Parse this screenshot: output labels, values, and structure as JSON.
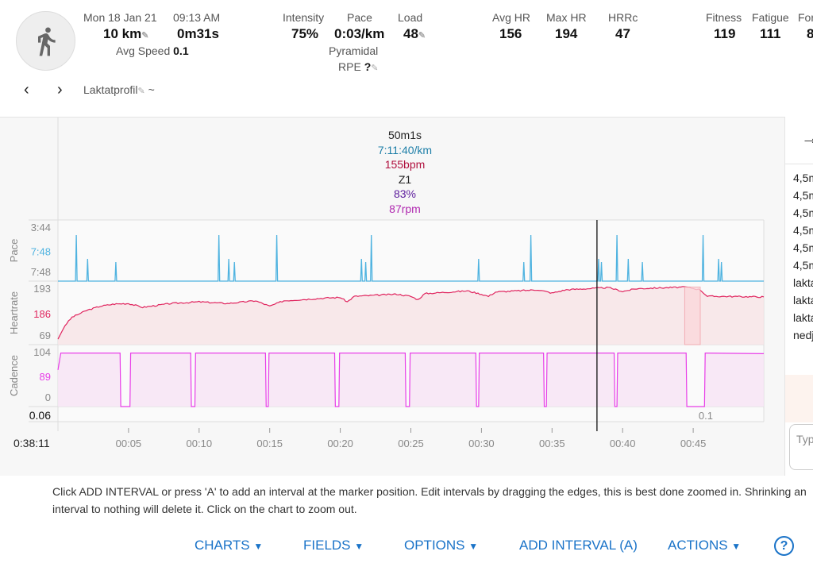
{
  "header": {
    "date": "Mon 18 Jan 21",
    "time": "09:13 AM",
    "distance": "10 km",
    "duration": "0m31s",
    "avg_speed_label": "Avg Speed",
    "avg_speed": "0.1",
    "intensity_label": "Intensity",
    "intensity": "75%",
    "pace_label": "Pace",
    "pace": "0:03/km",
    "load_label": "Load",
    "load": "48",
    "type": "Pyramidal",
    "rpe_label": "RPE",
    "rpe": "?",
    "avg_hr_label": "Avg HR",
    "avg_hr": "156",
    "max_hr_label": "Max HR",
    "max_hr": "194",
    "hrrc_label": "HRRc",
    "hrrc": "47",
    "fitness_label": "Fitness",
    "fitness": "119",
    "fatigue_label": "Fatigue",
    "fatigue": "111",
    "form_label": "For",
    "form": "8",
    "activity_name": "Laktatprofil",
    "activity_suffix": "~"
  },
  "tooltip": {
    "time": "50m1s",
    "pace": "7:11:40/km",
    "hr": "155bpm",
    "zone": "Z1",
    "pct": "83%",
    "cadence": "87rpm"
  },
  "chart_data": {
    "type": "line",
    "x_unit": "minutes",
    "xlim": [
      0,
      50
    ],
    "x_ticks": [
      "00:05",
      "00:10",
      "00:15",
      "00:20",
      "00:25",
      "00:30",
      "00:35",
      "00:40",
      "00:45"
    ],
    "marker_time": "0:38:11",
    "bottom_left_value": "0.06",
    "bottom_right_value": "0.1",
    "panels": [
      {
        "name": "Pace",
        "color": "#4fb3e0",
        "ticks": [
          "3:44",
          "7:48",
          "7:48"
        ],
        "highlight": "7:48",
        "spikes": [
          1.3,
          2.1,
          4.1,
          11.4,
          12.1,
          12.5,
          15.5,
          21.5,
          21.8,
          22.2,
          29.8,
          33.0,
          33.5,
          38.3,
          38.5,
          39.6,
          40.4,
          41.4,
          45.7,
          46.8,
          47.0
        ]
      },
      {
        "name": "Heartrate",
        "color": "#e0245e",
        "ticks": [
          "193",
          "186",
          "69"
        ],
        "highlight": "186",
        "points": [
          [
            0,
            100
          ],
          [
            0.5,
            125
          ],
          [
            1,
            140
          ],
          [
            2,
            152
          ],
          [
            3,
            160
          ],
          [
            4,
            164
          ],
          [
            5,
            165
          ],
          [
            6,
            158
          ],
          [
            8,
            165
          ],
          [
            10,
            168
          ],
          [
            12,
            165
          ],
          [
            14,
            170
          ],
          [
            15,
            160
          ],
          [
            16,
            170
          ],
          [
            19,
            175
          ],
          [
            20,
            176
          ],
          [
            20.5,
            168
          ],
          [
            21,
            178
          ],
          [
            24,
            182
          ],
          [
            25,
            178
          ],
          [
            25.5,
            172
          ],
          [
            26,
            183
          ],
          [
            29,
            188
          ],
          [
            30,
            182
          ],
          [
            30.5,
            178
          ],
          [
            31,
            186
          ],
          [
            34,
            190
          ],
          [
            35,
            184
          ],
          [
            36,
            190
          ],
          [
            39,
            194
          ],
          [
            40,
            187
          ],
          [
            41,
            192
          ],
          [
            44.5,
            195
          ],
          [
            45.5,
            190
          ],
          [
            46,
            178
          ],
          [
            47,
            178
          ],
          [
            50,
            177
          ]
        ]
      },
      {
        "name": "Cadence",
        "color": "#e83ee8",
        "ticks": [
          "104",
          "89",
          "0"
        ],
        "highlight": "89",
        "baseline": 95,
        "drops": [
          [
            4.4,
            5.1
          ],
          [
            9.4,
            9.7
          ],
          [
            14.7,
            14.9
          ],
          [
            19.6,
            19.9
          ],
          [
            24.6,
            24.9
          ],
          [
            29.6,
            29.8
          ],
          [
            34.4,
            34.6
          ],
          [
            39.4,
            39.6
          ],
          [
            44.5,
            45.8
          ]
        ]
      }
    ]
  },
  "side": {
    "items": [
      "4,5m",
      "4,5m",
      "4,5m",
      "4,5m",
      "4,5m",
      "4,5m",
      "laktat",
      "laktat",
      "laktat",
      "nedjo"
    ],
    "input_placeholder": "Type"
  },
  "help": {
    "text": "Click ADD INTERVAL or press 'A' to add an interval at the marker position. Edit intervals by dragging the edges, this is best done zoomed in. Shrinking an interval to nothing will delete it. Click on the chart to zoom out."
  },
  "toolbar": {
    "charts": "CHARTS",
    "fields": "FIELDS",
    "options": "OPTIONS",
    "add_interval": "ADD INTERVAL (A)",
    "actions": "ACTIONS",
    "help": "?"
  },
  "colors": {
    "accent": "#1a73c8",
    "pace": "#4fb3e0",
    "hr": "#e0245e",
    "cadence": "#e83ee8"
  }
}
